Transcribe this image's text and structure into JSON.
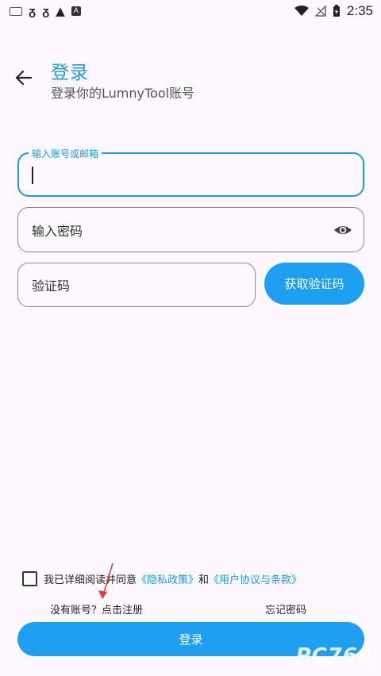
{
  "status_bar": {
    "time": "2:35",
    "left_icons": [
      "keyboard-icon",
      "notify-icon",
      "notify-icon",
      "warning-icon",
      "app-a-icon"
    ],
    "right_icons": [
      "wifi-icon",
      "no-signal-icon",
      "battery-icon"
    ],
    "app_a_letter": "A"
  },
  "header": {
    "title": "登录",
    "subtitle": "登录你的LumnyTool账号"
  },
  "form": {
    "account_label": "输入账号或邮箱",
    "password_placeholder": "输入密码",
    "code_placeholder": "验证码",
    "get_code_label": "获取验证码"
  },
  "agreement": {
    "prefix": "我已详细阅读并同意",
    "privacy_link": "《隐私政策》",
    "and": "和",
    "terms_link": "《用户协议与条款》"
  },
  "links": {
    "register": "没有账号？点击注册",
    "forgot": "忘记密码"
  },
  "login_button": "登录",
  "colors": {
    "accent": "#1e9ff2",
    "background": "#fdf8fd",
    "annotation": "#e53935"
  },
  "watermark": "PC768"
}
